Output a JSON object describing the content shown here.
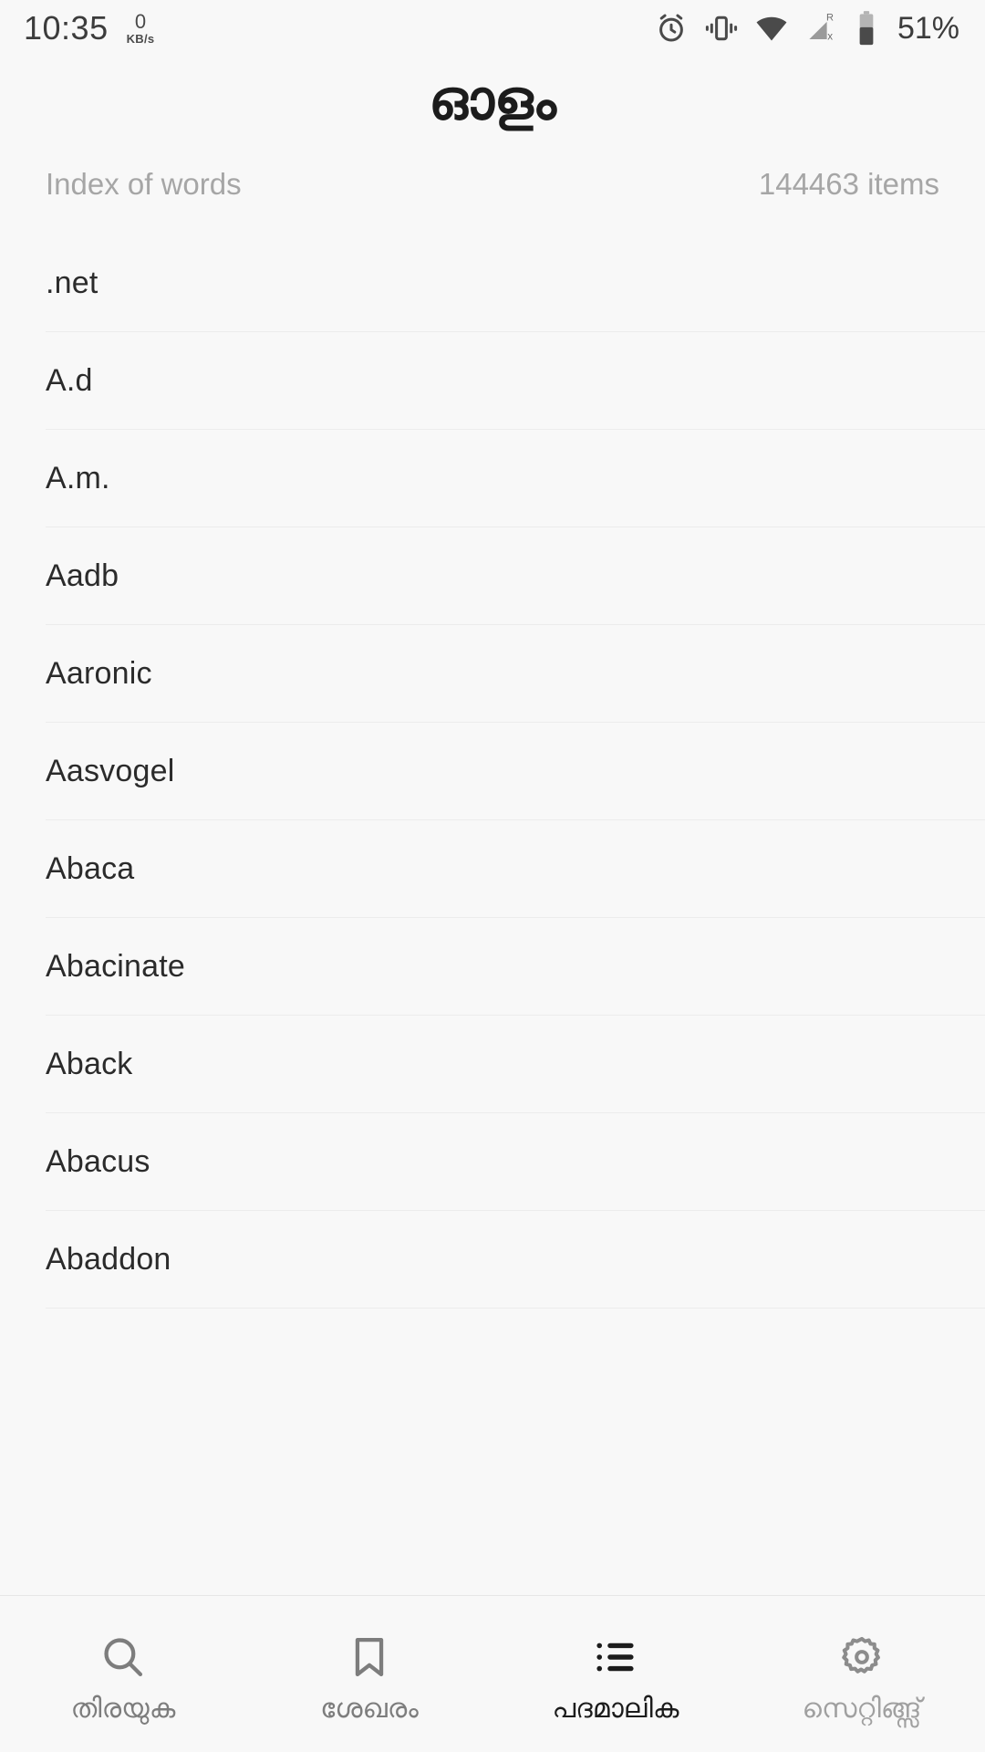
{
  "statusbar": {
    "time": "10:35",
    "net_speed_value": "0",
    "net_speed_unit": "KB/s",
    "battery_percent": "51%",
    "icons": [
      "alarm-icon",
      "vibrate-icon",
      "wifi-icon",
      "signal-roaming-off-icon",
      "battery-icon"
    ]
  },
  "header": {
    "app_title": "ഓളം",
    "section_label": "Index of words",
    "items_count": "144463 items"
  },
  "wordlist": {
    "items": [
      ".net",
      "A.d",
      "A.m.",
      "Aadb",
      "Aaronic",
      "Aasvogel",
      "Abaca",
      "Abacinate",
      "Aback",
      "Abacus",
      "Abaddon"
    ]
  },
  "bottomnav": {
    "tabs": [
      {
        "label": "തിരയുക",
        "icon": "search-icon",
        "state": "inactive"
      },
      {
        "label": "ശേഖരം",
        "icon": "bookmark-icon",
        "state": "inactive"
      },
      {
        "label": "പദമാലിക",
        "icon": "list-icon",
        "state": "active"
      },
      {
        "label": "സെറ്റിങ്ങ്സ്",
        "icon": "gear-icon",
        "state": "inactive-light"
      }
    ]
  },
  "colors": {
    "background": "#f8f8f8",
    "text_primary": "#2b2b2b",
    "text_muted": "#a6a6a6",
    "divider": "#ececec",
    "nav_active": "#1c1c1c",
    "nav_inactive": "#7d7d7d"
  }
}
